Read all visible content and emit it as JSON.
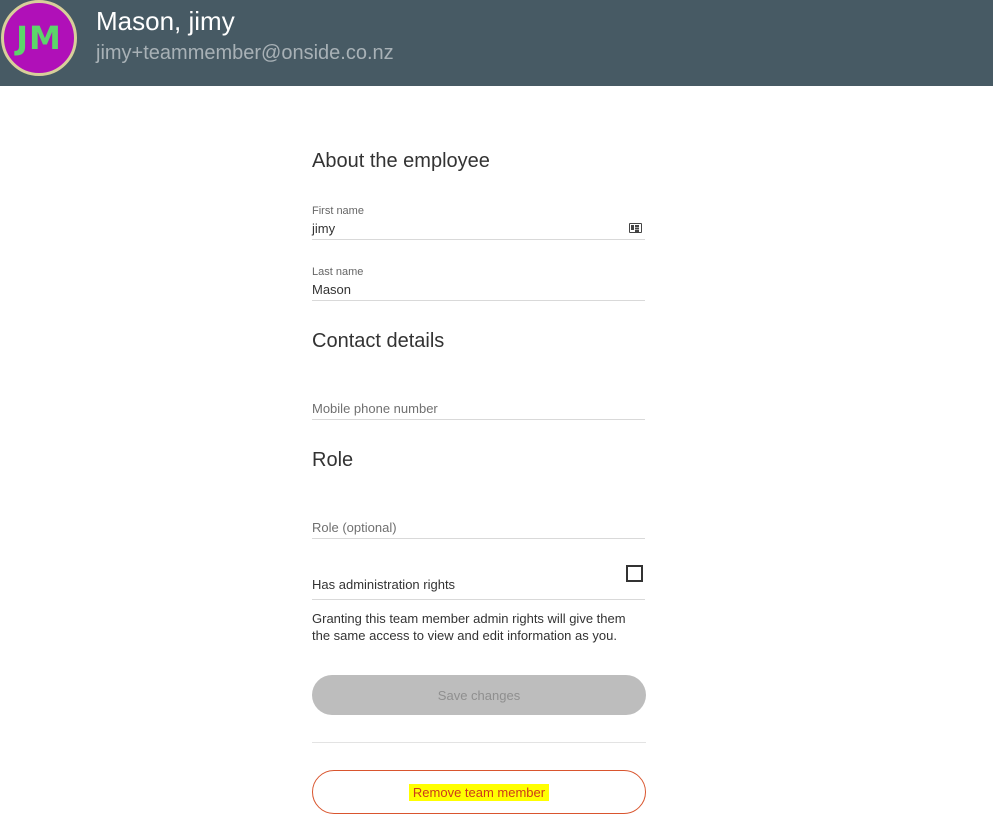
{
  "header": {
    "avatar_initials": "JM",
    "name": "Mason, jimy",
    "email": "jimy+teammember@onside.co.nz"
  },
  "about": {
    "title": "About the employee",
    "first_name_label": "First name",
    "first_name_value": "jimy",
    "last_name_label": "Last name",
    "last_name_value": "Mason"
  },
  "contact": {
    "title": "Contact details",
    "mobile_placeholder": "Mobile phone number"
  },
  "role": {
    "title": "Role",
    "role_placeholder": "Role (optional)",
    "admin_label": "Has administration rights",
    "admin_checked": false,
    "admin_note": "Granting this team member admin rights will give them the same access to view and edit information as you."
  },
  "actions": {
    "save_label": "Save changes",
    "remove_label": "Remove team member"
  },
  "colors": {
    "header_bg": "#475a64",
    "avatar_bg": "#b010b8",
    "remove_border": "#d9552e",
    "highlight": "#ffff00"
  },
  "icons": {
    "first_name_field": "contact-card-icon"
  }
}
